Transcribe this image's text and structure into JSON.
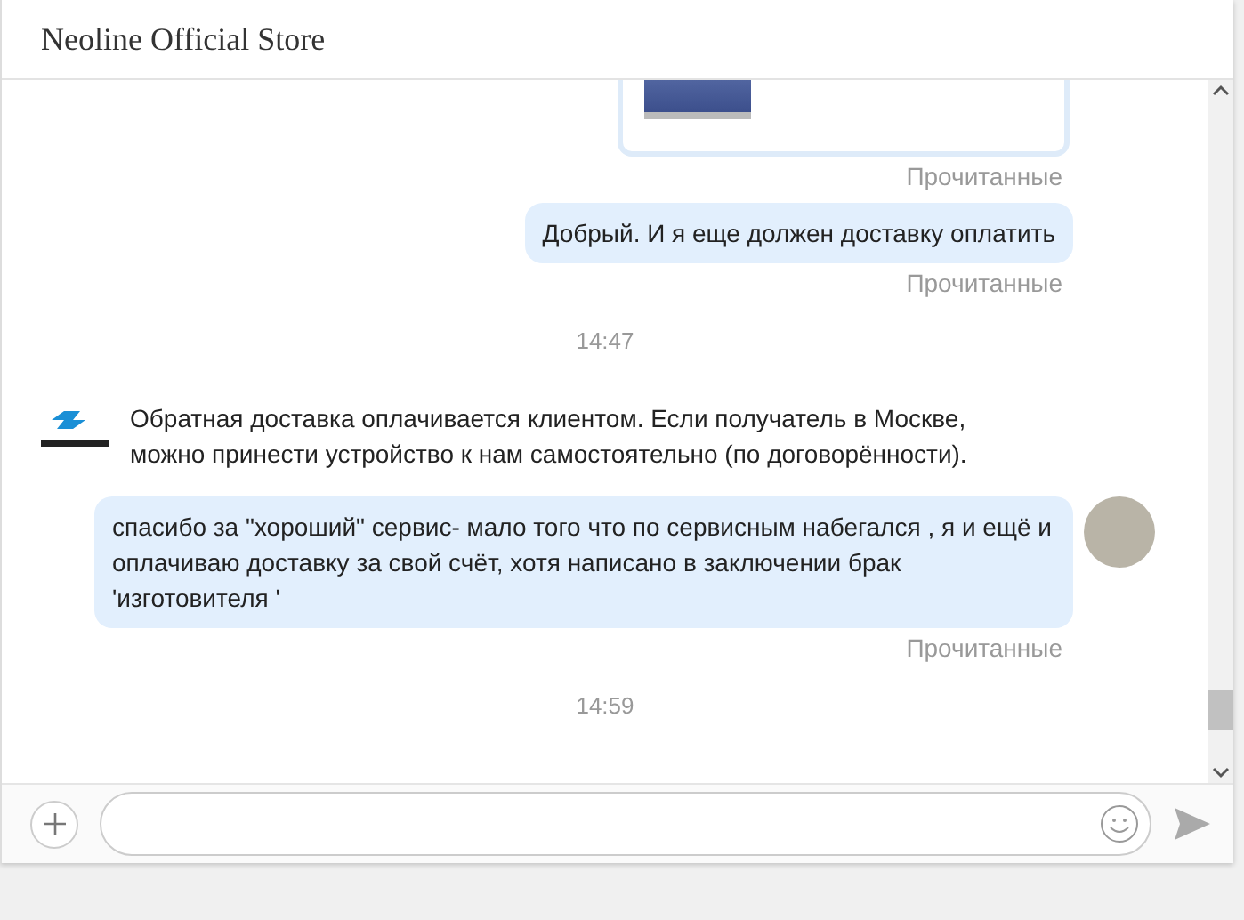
{
  "window": {
    "title": "Neoline Official Store"
  },
  "messages": [
    {
      "kind": "product"
    },
    {
      "kind": "status",
      "text": "Прочитанные"
    },
    {
      "kind": "outgoing",
      "text": "Добрый. И я еще должен доставку оплатить",
      "avatar": false
    },
    {
      "kind": "status",
      "text": "Прочитанные"
    },
    {
      "kind": "time",
      "text": "14:47"
    },
    {
      "kind": "incoming",
      "text": "Обратная доставка оплачивается клиентом. Если получатель в Москве, можно принести устройство к нам самостоятельно (по договорённости)."
    },
    {
      "kind": "outgoing",
      "text": "спасибо за \"хороший\" сервис- мало того что по сервисным набегался , я и ещё и оплачиваю доставку за свой счёт, хотя написано в заключении брак 'изготовителя '",
      "avatar": true
    },
    {
      "kind": "status",
      "text": "Прочитанные"
    },
    {
      "kind": "time",
      "text": "14:59"
    }
  ]
}
